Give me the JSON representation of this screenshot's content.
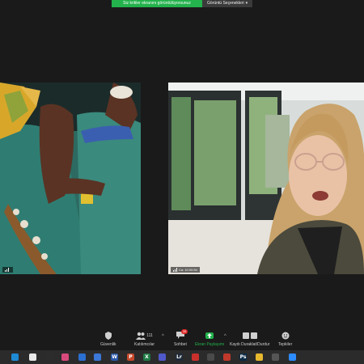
{
  "share_banner": {
    "status": "Siz kritiler ekranını görüntülüyorsunuz",
    "options_label": "Görüntü Seçenekleri"
  },
  "participants": [
    {
      "name": "",
      "signal_bars": 3
    },
    {
      "name": "Ca: 10:00:54",
      "signal_bars": 3
    }
  ],
  "toolbar": {
    "security": {
      "label": "Güvenlik",
      "icon": "shield-icon"
    },
    "participants": {
      "label": "Katılımcılar",
      "count": "111",
      "icon": "participants-icon"
    },
    "chat": {
      "label": "Sohbet",
      "badge": "35",
      "icon": "chat-icon"
    },
    "share": {
      "label": "Ekran Paylaşımı",
      "icon": "share-screen-icon",
      "color": "#23b24c"
    },
    "record": {
      "label": "Kaydı Duraklat/Durdur",
      "icon": "pause-stop-icon"
    },
    "reactions": {
      "label": "Tepkiler",
      "icon": "reactions-icon"
    }
  },
  "taskbar": {
    "icons": [
      {
        "name": "edge-icon",
        "color": "#1f8ad4"
      },
      {
        "name": "calendar-icon",
        "color": "#e9e9e9"
      },
      {
        "name": "media-icon",
        "color": "#2c2c2c"
      },
      {
        "name": "photos-icon",
        "color": "#d94a7c"
      },
      {
        "name": "mail-icon",
        "color": "#2b6fd1"
      },
      {
        "name": "store-icon",
        "color": "#3b78d8"
      },
      {
        "name": "word-icon",
        "color": "#2b57a6",
        "letter": "W"
      },
      {
        "name": "powerpoint-icon",
        "color": "#c7482a",
        "letter": "P"
      },
      {
        "name": "excel-icon",
        "color": "#1f7a45",
        "letter": "X"
      },
      {
        "name": "teams-icon",
        "color": "#5059c9"
      },
      {
        "name": "lightroom-icon",
        "color": "#1e2a3a",
        "letter": "Lr"
      },
      {
        "name": "pdf-icon",
        "color": "#c9302c"
      },
      {
        "name": "files-icon",
        "color": "#4a4a4a"
      },
      {
        "name": "app-icon",
        "color": "#c0392b"
      },
      {
        "name": "photoshop-icon",
        "color": "#0b2a45",
        "letter": "Ps"
      },
      {
        "name": "chrome-icon",
        "color": "#e6b82e"
      },
      {
        "name": "camera-icon",
        "color": "#555555"
      },
      {
        "name": "zoom-icon",
        "color": "#2d8cff"
      }
    ]
  }
}
